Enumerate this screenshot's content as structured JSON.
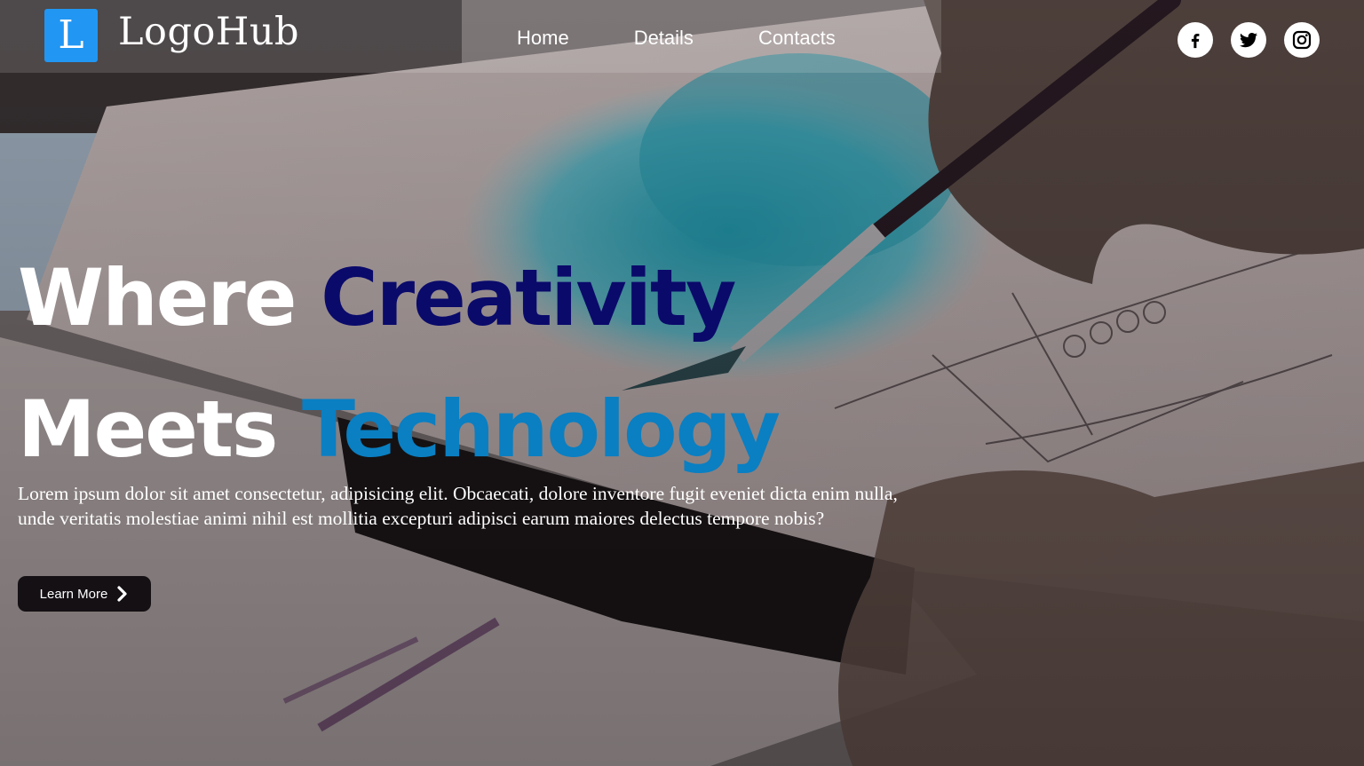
{
  "brand": {
    "logo_letter": "L",
    "name": "LogoHub",
    "logo_color": "#2196f3"
  },
  "nav": {
    "items": [
      "Home",
      "Details",
      "Contacts"
    ]
  },
  "social": {
    "icons": [
      "facebook-icon",
      "twitter-icon",
      "instagram-icon"
    ]
  },
  "hero": {
    "title_line1_white": "Where",
    "title_line1_accent": "Creativity",
    "title_line2_white": "Meets",
    "title_line2_accent": "Technology",
    "accent_color_1": "#0a0a6b",
    "accent_color_2": "#0a7fc2",
    "body": "Lorem ipsum dolor sit amet consectetur, adipisicing elit. Obcaecati, dolore inventore fugit eveniet dicta enim nulla, unde veritatis molestiae animi nihil est mollitia excepturi adipisci earum maiores delectus tempore nobis?",
    "cta_label": "Learn More"
  }
}
